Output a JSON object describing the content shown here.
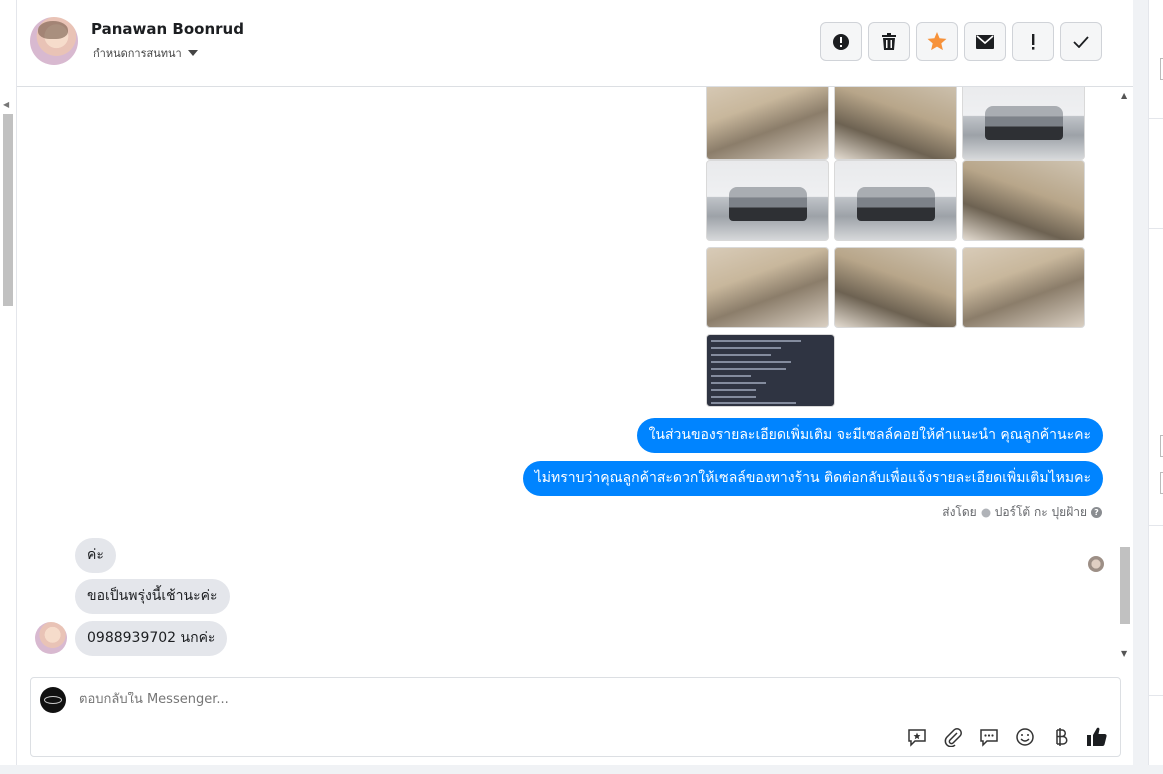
{
  "header": {
    "name": "Panawan Boonrud",
    "subtitle": "กำหนดการสนทนา",
    "actions": [
      {
        "name": "report-button",
        "icon": "alert-circle-icon"
      },
      {
        "name": "delete-button",
        "icon": "trash-icon"
      },
      {
        "name": "star-button",
        "icon": "star-icon"
      },
      {
        "name": "mark-unread-button",
        "icon": "envelope-icon"
      },
      {
        "name": "spam-button",
        "icon": "exclamation-icon"
      },
      {
        "name": "done-button",
        "icon": "check-icon"
      }
    ]
  },
  "messages": {
    "outgoing": [
      "ในส่วนของรายละเอียดเพิ่มเติม จะมีเซลล์คอยให้คำแนะนำ คุณลูกค้านะคะ",
      "ไม่ทราบว่าคุณลูกค้าสะดวกให้เซลล์ของทางร้าน ติดต่อกลับเพื่อแจ้งรายละเอียดเพิ่มเติมไหมคะ"
    ],
    "sent_by_prefix": "ส่งโดย",
    "sent_by_name": "ปอร์โต้ กะ ปุยฝ้าย",
    "incoming": [
      "ค่ะ",
      "ขอเป็นพรุ่งนี้เช้านะค่ะ",
      "0988939702 นกค่ะ"
    ]
  },
  "composer": {
    "placeholder": "ตอบกลับใน Messenger...",
    "tools": [
      "saved-reply-icon",
      "attach-icon",
      "chat-bubble-icon",
      "emoji-icon",
      "baht-icon",
      "thumbs-up-icon"
    ]
  },
  "colors": {
    "outgoing_bubble": "#0084ff",
    "incoming_bubble": "#e4e6eb",
    "star": "#f7923a"
  }
}
